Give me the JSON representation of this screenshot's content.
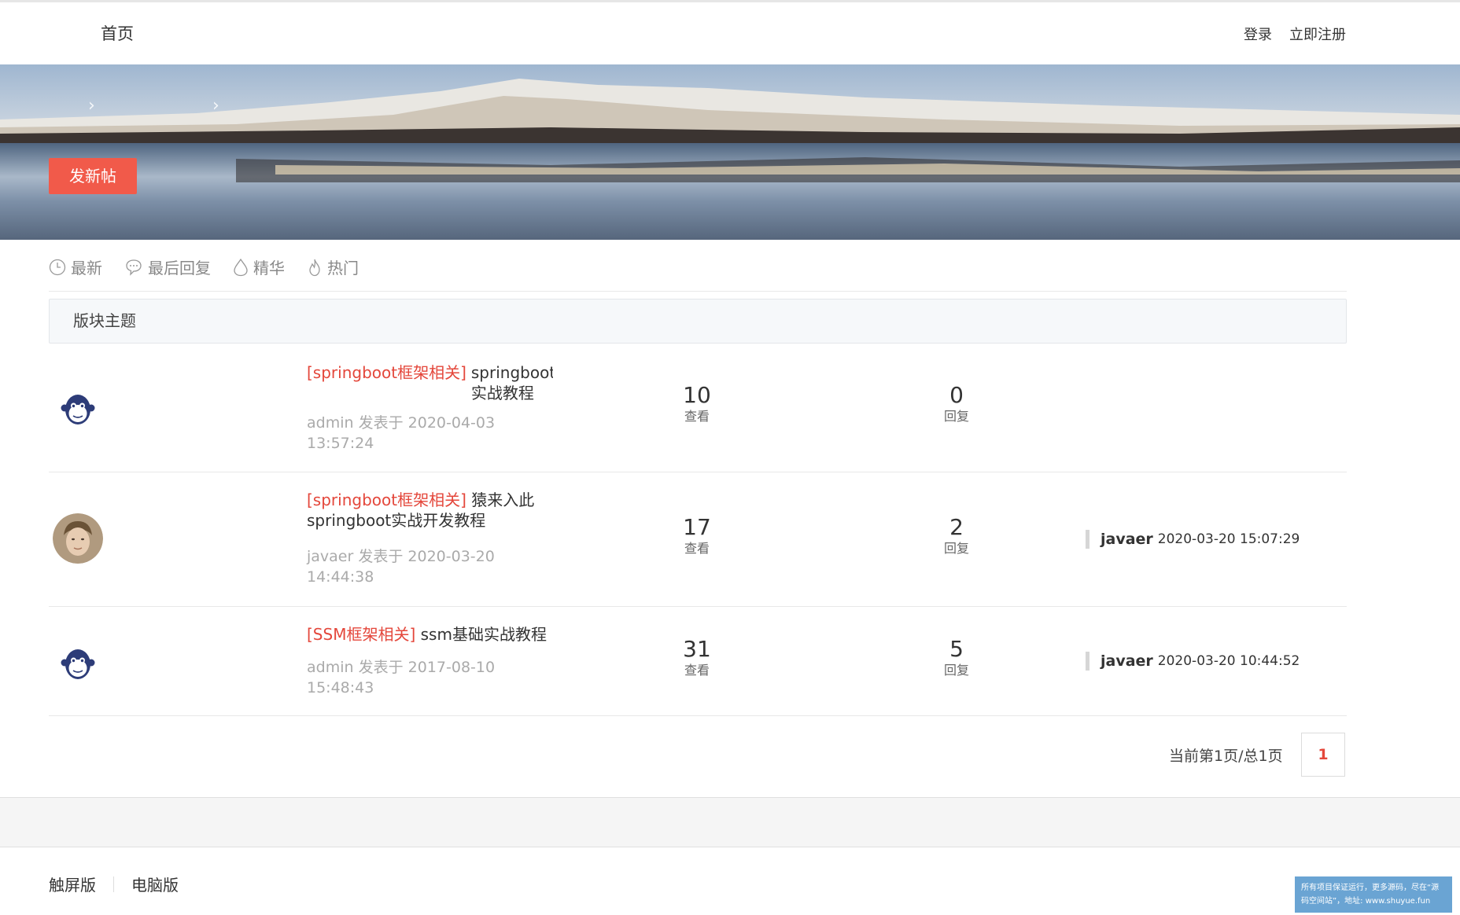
{
  "header": {
    "home": "首页",
    "login": "登录",
    "register": "立即注册"
  },
  "banner": {
    "post_button": "发新帖"
  },
  "tabs": [
    {
      "label": "最新",
      "icon": "clock-icon"
    },
    {
      "label": "最后回复",
      "icon": "chat-bubble-icon"
    },
    {
      "label": "精华",
      "icon": "droplet-icon"
    },
    {
      "label": "热门",
      "icon": "flame-icon"
    }
  ],
  "section": {
    "title": "版块主题"
  },
  "threads": [
    {
      "category": "[springboot框架相关]",
      "title": "springboot实战教程",
      "author": "admin",
      "posted_label": "发表于",
      "posted_at": "2020-04-03 13:57:24",
      "views": "10",
      "views_label": "查看",
      "replies": "0",
      "replies_label": "回复",
      "last_user": "",
      "last_time": "",
      "avatar": "monkey-avatar"
    },
    {
      "category": "[springboot框架相关]",
      "title": "猿来入此springboot实战开发教程",
      "author": "javaer",
      "posted_label": "发表于",
      "posted_at": "2020-03-20 14:44:38",
      "views": "17",
      "views_label": "查看",
      "replies": "2",
      "replies_label": "回复",
      "last_user": "javaer",
      "last_time": "2020-03-20 15:07:29",
      "avatar": "photo-avatar"
    },
    {
      "category": "[SSM框架相关]",
      "title": "ssm基础实战教程",
      "author": "admin",
      "posted_label": "发表于",
      "posted_at": "2017-08-10 15:48:43",
      "views": "31",
      "views_label": "查看",
      "replies": "5",
      "replies_label": "回复",
      "last_user": "javaer",
      "last_time": "2020-03-20 10:44:52",
      "avatar": "monkey-avatar"
    }
  ],
  "pagination": {
    "summary": "当前第1页/总1页",
    "current": "1"
  },
  "footer": {
    "touch": "触屏版",
    "desktop": "电脑版",
    "watermark": "所有项目保证运行，更多源码，尽在“源码空间站”，地址: www.shuyue.fun"
  },
  "colors": {
    "accent": "#f15a4a",
    "category": "#e4473b"
  }
}
